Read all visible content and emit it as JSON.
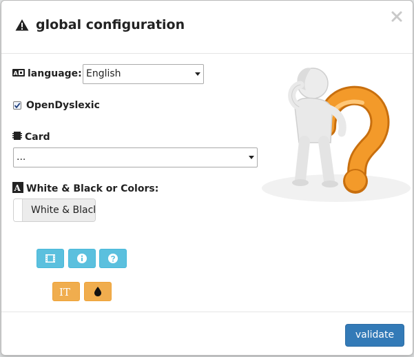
{
  "modal": {
    "title": "global configuration"
  },
  "language": {
    "label": "language:",
    "selected": "English"
  },
  "dyslexic": {
    "label": "OpenDyslexic",
    "checked": true
  },
  "card": {
    "label": "Card",
    "selected": "..."
  },
  "colors": {
    "label": "White & Black or Colors:",
    "toggle_value": "White & Black"
  },
  "toolbar": {
    "icons": [
      "film-icon",
      "info-icon",
      "question-icon"
    ],
    "accent_info": "#5bc0de"
  },
  "tools": {
    "icons": [
      "text-size-icon",
      "tint-icon"
    ],
    "text_size_glyph": "IT",
    "accent_warning": "#f0ad4e"
  },
  "footer": {
    "validate_label": "validate",
    "accent_primary": "#337ab7"
  }
}
